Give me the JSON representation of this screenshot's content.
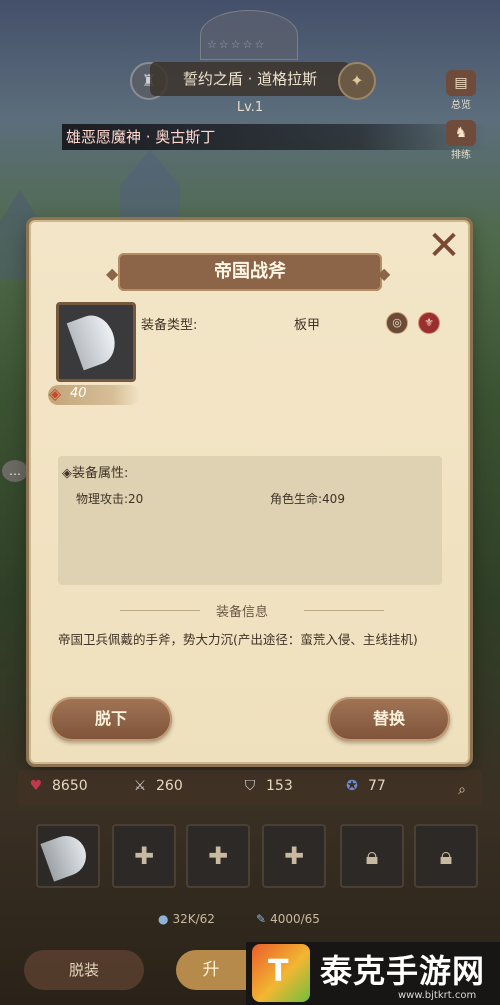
{
  "hero": {
    "name": "誓约之盾 · 道格拉斯",
    "level": "Lv.1",
    "title_banner": "雄恶愿魔神 · 奥古斯丁",
    "stars": "☆☆☆☆☆"
  },
  "side_menu": {
    "item1": "总览",
    "item2": "排练"
  },
  "modal": {
    "title": "帝国战斧",
    "equip_type_label": "装备类型:",
    "equip_type_value": "板甲",
    "power_value": "40",
    "attributes_title": "◈装备属性:",
    "attributes": [
      {
        "text": "物理攻击:20"
      },
      {
        "text": "角色生命:409"
      }
    ],
    "info_heading": "装备信息",
    "info_text": "帝国卫兵佩戴的手斧，势大力沉(产出途径：蛮荒入侵、主线挂机)",
    "button_remove": "脱下",
    "button_replace": "替换"
  },
  "stats": {
    "hp": "8650",
    "attack": "260",
    "defense": "153",
    "magic_def": "77"
  },
  "resources": {
    "r1": "32K/62",
    "r2": "4000/65"
  },
  "bottom": {
    "unequip_label": "脱装",
    "upgrade_label": "升"
  },
  "watermark": {
    "brand": "泰克手游网",
    "url": "www.bjtkrt.com"
  },
  "colors": {
    "modal_bg": "#f0e2c1",
    "banner": "#8c6447",
    "button": "#8f6348"
  }
}
